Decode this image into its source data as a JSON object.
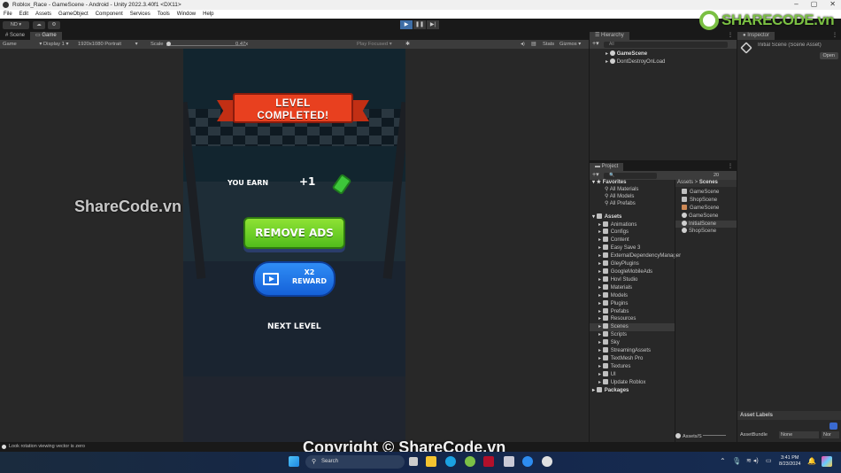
{
  "window": {
    "title": "Roblox_Race - GameScene - Android - Unity 2022.3.40f1 <DX11>",
    "controls": [
      "–",
      "▢",
      "✕"
    ]
  },
  "menu": [
    "File",
    "Edit",
    "Assets",
    "GameObject",
    "Component",
    "Services",
    "Tools",
    "Window",
    "Help"
  ],
  "toolbar": {
    "account": "ND ▾",
    "cloud_icon": "cloud-icon",
    "collab_icon": "services-icon",
    "play": "▶",
    "pause": "❚❚",
    "step": "▶|"
  },
  "game_panel": {
    "tabs": [
      {
        "label": "# Scene",
        "active": false
      },
      {
        "label": "Game",
        "active": true
      }
    ],
    "controls": {
      "mode": "Game",
      "display": "Display 1",
      "resolution": "1920x1080 Portrait",
      "scale_label": "Scale",
      "scale_value": "0.47x",
      "play_mode": "Play Focused",
      "stats": "Stats",
      "gizmos": "Gizmos"
    }
  },
  "game": {
    "banner_line1": "LEVEL",
    "banner_line2": "COMPLETED!",
    "earn_label": "YOU EARN",
    "earn_amount": "+1",
    "remove_ads": "REMOVE ADS",
    "reward_line1": "X2",
    "reward_line2": "REWARD",
    "next_level": "NEXT LEVEL",
    "colors": {
      "banner": "#e8401f",
      "remove_ads": "#6ccf27",
      "reward": "#2276ea",
      "background": "#12252f"
    }
  },
  "hierarchy": {
    "tab": "Hierarchy",
    "search_placeholder": "All",
    "items": [
      "GameScene",
      "DontDestroyOnLoad"
    ]
  },
  "project": {
    "tab": "Project",
    "hidden_count": "20",
    "favorites_label": "Favorites",
    "favorites": [
      "All Materials",
      "All Models",
      "All Prefabs"
    ],
    "assets_label": "Assets",
    "folders": [
      "Animations",
      "Configs",
      "Content",
      "Easy Save 3",
      "ExternalDependencyManager",
      "GleyPlugins",
      "GoogleMobileAds",
      "Hovl Studio",
      "Materials",
      "Models",
      "Plugins",
      "Prefabs",
      "Resources",
      "Scenes",
      "Scripts",
      "Sky",
      "StreamingAssets",
      "TextMesh Pro",
      "Textures",
      "UI",
      "Update Roblox"
    ],
    "selected_folder": "Scenes",
    "packages_label": "Packages",
    "breadcrumb": [
      "Assets",
      "Scenes"
    ],
    "files": [
      {
        "name": "GameScene",
        "type": "folder"
      },
      {
        "name": "ShopScene",
        "type": "folder"
      },
      {
        "name": "GameScene",
        "type": "lighting"
      },
      {
        "name": "GameScene",
        "type": "scene"
      },
      {
        "name": "InitialScene",
        "type": "scene",
        "selected": true
      },
      {
        "name": "ShopScene",
        "type": "scene"
      }
    ],
    "footer_path": "Assets/S"
  },
  "inspector": {
    "tab": "Inspector",
    "title": "Initial Scene (Scene Asset)",
    "open_button": "Open",
    "labels_header": "Asset Labels",
    "bundle_label": "AssetBundle",
    "bundle_value": "None",
    "variant_value": "Nor"
  },
  "status": {
    "message": "Look rotation viewing vector is zero"
  },
  "taskbar": {
    "search": "Search",
    "time": "3:41 PM",
    "date": "8/23/2024"
  },
  "watermarks": {
    "center": "ShareCode.vn",
    "copyright": "Copyright © ShareCode.vn",
    "logo": "SHARECODE.vn"
  }
}
